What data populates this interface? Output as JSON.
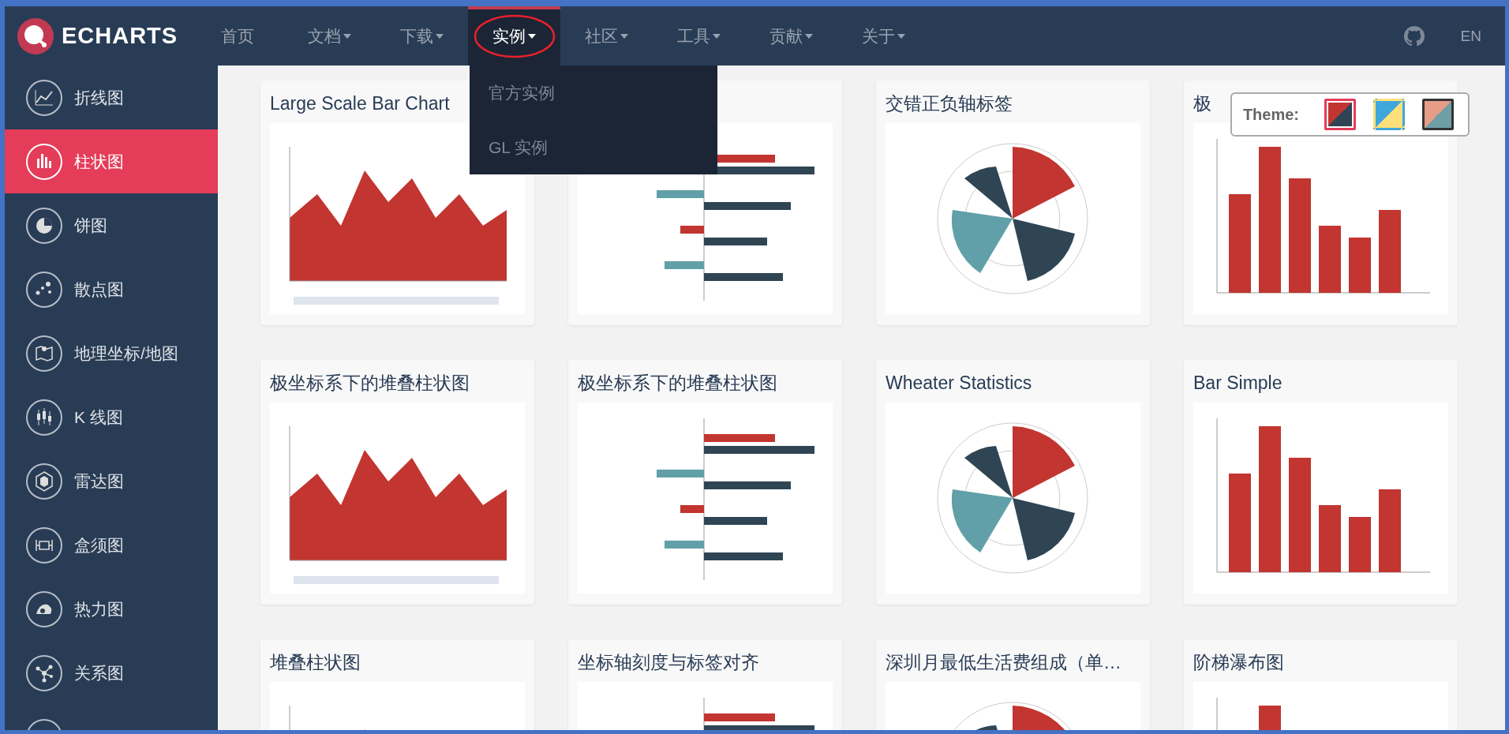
{
  "logo": {
    "text": "ECHARTS"
  },
  "nav": [
    {
      "label": "首页",
      "has_menu": false,
      "selected": false,
      "circled": false
    },
    {
      "label": "文档",
      "has_menu": true,
      "selected": false,
      "circled": false
    },
    {
      "label": "下载",
      "has_menu": true,
      "selected": false,
      "circled": false
    },
    {
      "label": "实例",
      "has_menu": true,
      "selected": true,
      "circled": true
    },
    {
      "label": "社区",
      "has_menu": true,
      "selected": false,
      "circled": false
    },
    {
      "label": "工具",
      "has_menu": true,
      "selected": false,
      "circled": false
    },
    {
      "label": "贡献",
      "has_menu": true,
      "selected": false,
      "circled": false
    },
    {
      "label": "关于",
      "has_menu": true,
      "selected": false,
      "circled": false
    }
  ],
  "dropdown": [
    "官方实例",
    "GL 实例"
  ],
  "language": "EN",
  "sidebar": [
    {
      "label": "折线图",
      "selected": false
    },
    {
      "label": "柱状图",
      "selected": true
    },
    {
      "label": "饼图",
      "selected": false
    },
    {
      "label": "散点图",
      "selected": false
    },
    {
      "label": "地理坐标/地图",
      "selected": false
    },
    {
      "label": "K 线图",
      "selected": false
    },
    {
      "label": "雷达图",
      "selected": false
    },
    {
      "label": "盒须图",
      "selected": false
    },
    {
      "label": "热力图",
      "selected": false
    },
    {
      "label": "关系图",
      "selected": false
    }
  ],
  "cards": [
    {
      "title": "Large Scale Bar Chart",
      "preview": {
        "kind": "picture"
      }
    },
    {
      "preview": {
        "kind": "picture"
      }
    },
    {
      "title": "交错正负轴标签",
      "preview": {
        "kind": "picture"
      }
    },
    {
      "title": "极",
      "preview": {
        "kind": "picture"
      }
    },
    {
      "title": "极坐标系下的堆叠柱状图",
      "preview": {
        "kind": "picture"
      }
    },
    {
      "title": "极坐标系下的堆叠柱状图",
      "preview": {
        "kind": "picture"
      }
    },
    {
      "title": "Wheater Statistics",
      "preview": {
        "kind": "picture"
      }
    },
    {
      "title": "Bar Simple",
      "preview": {
        "kind": "picture"
      }
    },
    {
      "title": "堆叠柱状图",
      "preview": {
        "kind": "picture"
      }
    },
    {
      "title": "坐标轴刻度与标签对齐",
      "preview": {
        "kind": "picture"
      }
    },
    {
      "title": "深圳月最低生活费组成（单…",
      "preview": {
        "kind": "picture"
      }
    },
    {
      "title": "阶梯瀑布图",
      "preview": {
        "kind": "picture"
      }
    }
  ],
  "theme": {
    "label": "Theme:",
    "options": [
      {
        "color": "#c23531",
        "selected": true,
        "hovered": false
      },
      {
        "color": "#3fa7dc",
        "selected": false,
        "hovered": false
      },
      {
        "color": "#e69d87",
        "selected": false,
        "hovered": true
      }
    ]
  }
}
